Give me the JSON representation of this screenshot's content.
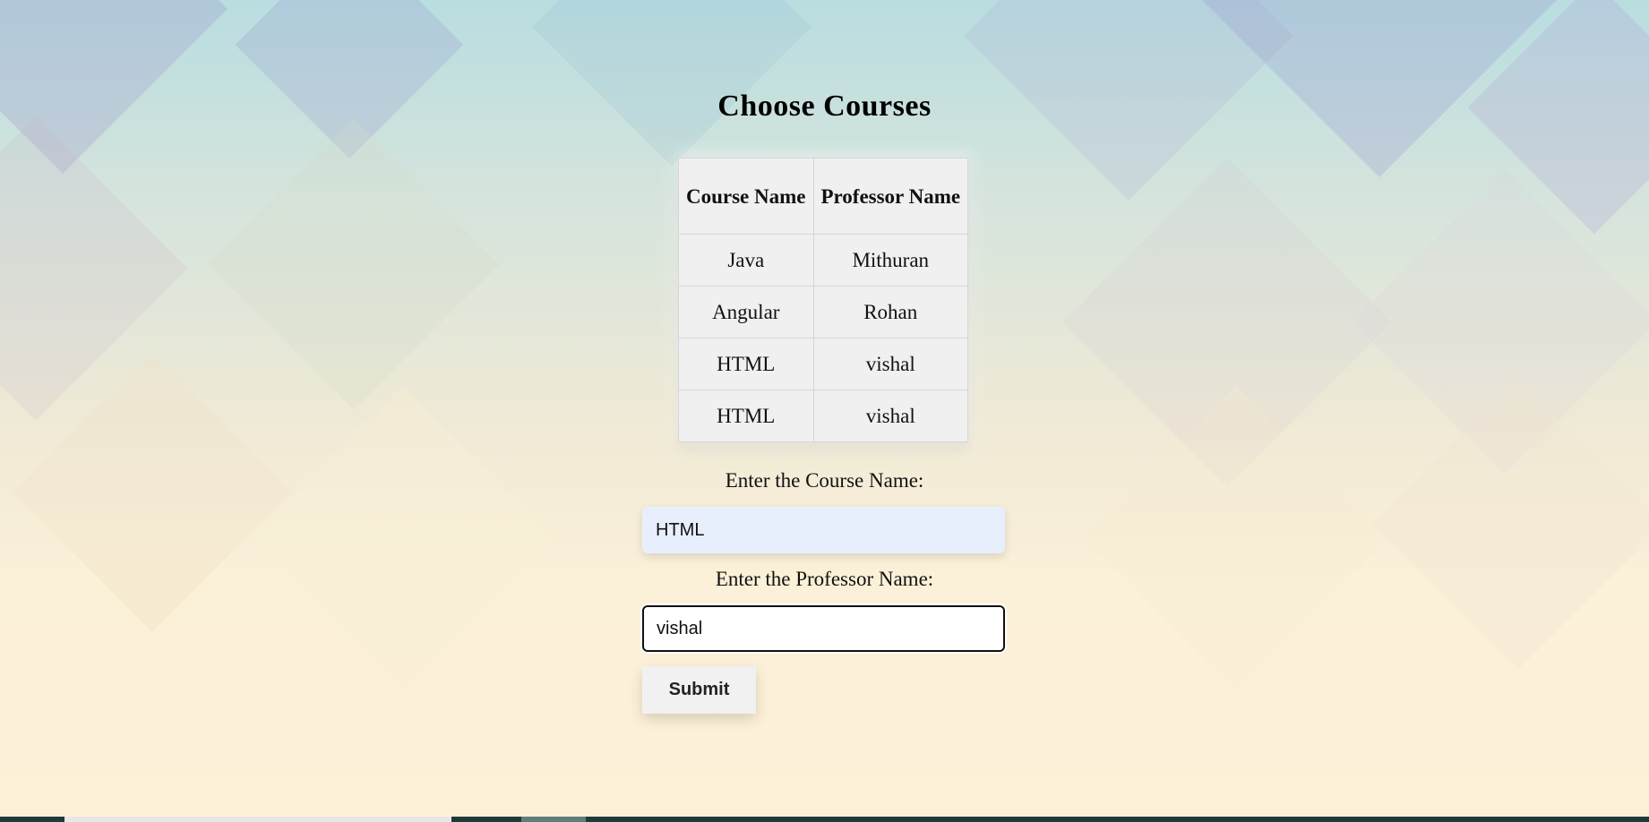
{
  "page": {
    "title": "Choose Courses"
  },
  "table": {
    "headers": [
      "Course Name",
      "Professor Name"
    ],
    "rows": [
      [
        "Java",
        "Mithuran"
      ],
      [
        "Angular",
        "Rohan"
      ],
      [
        "HTML",
        "vishal"
      ],
      [
        "HTML",
        "vishal"
      ]
    ]
  },
  "form": {
    "course_label": "Enter the Course Name:",
    "course_value": "HTML",
    "professor_label": "Enter the Professor Name:",
    "professor_value": "vishal",
    "submit_label": "Submit"
  },
  "colors": {
    "table_background": "#f0f0f0",
    "autofill_input_background": "#e8effc",
    "focused_input_border": "#111111",
    "taskbar": "#1e3a3a"
  }
}
